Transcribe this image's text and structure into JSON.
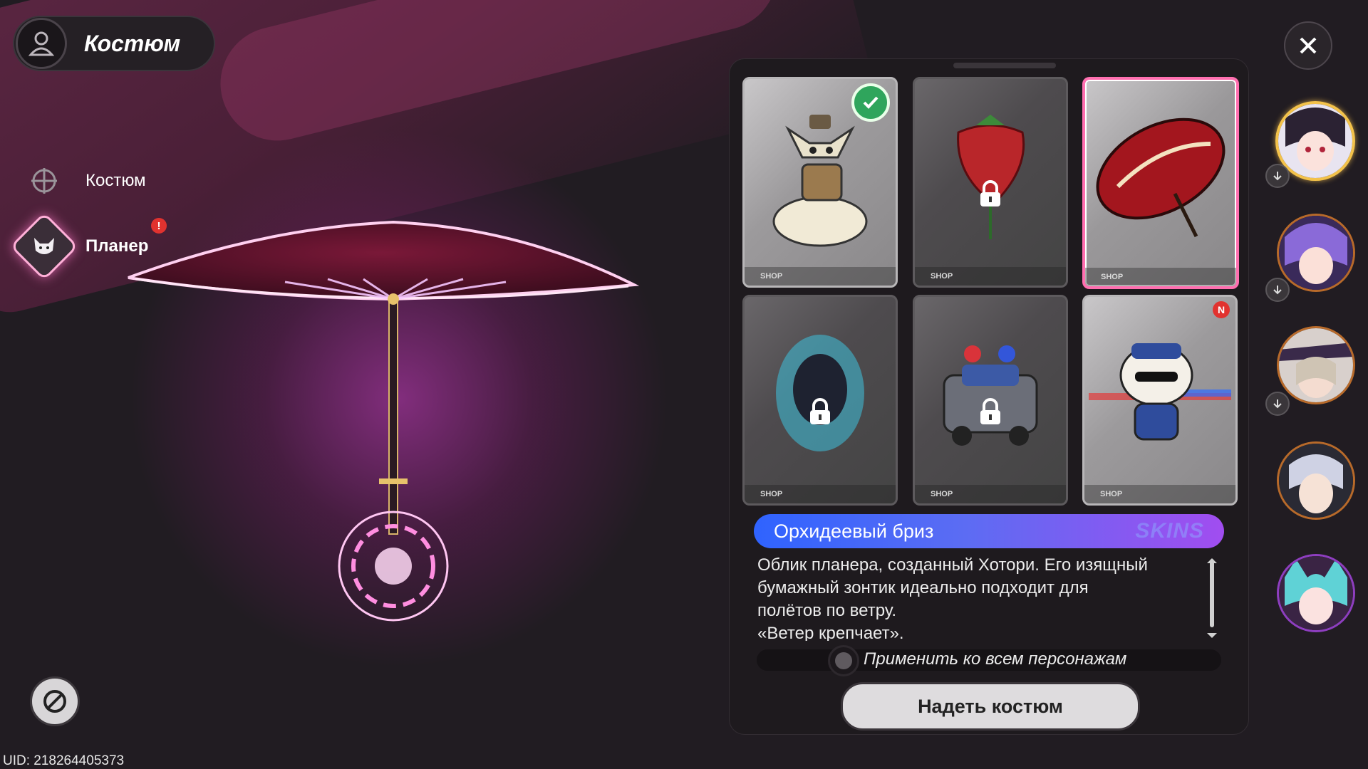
{
  "header": {
    "title": "Костюм",
    "avatar_icon": "person-outline-icon"
  },
  "sidebar": {
    "items": [
      {
        "label": "Костюм",
        "icon": "crosshair-icon",
        "active": false
      },
      {
        "label": "Планер",
        "icon": "glider-mascot-icon",
        "active": true,
        "alert": "!"
      }
    ]
  },
  "controls": {
    "close_icon": "close-icon",
    "block_icon": "block-icon"
  },
  "uid": "UID: 218264405373",
  "cards": [
    {
      "name": "card-mascot-pack",
      "foot": "SHOP",
      "locked": false,
      "equipped": true,
      "new": false,
      "style": "light"
    },
    {
      "name": "card-strawberry",
      "foot": "SHOP",
      "locked": true,
      "equipped": false,
      "new": false,
      "style": "dark"
    },
    {
      "name": "card-orchid-umbrella",
      "foot": "SHOP",
      "locked": false,
      "equipped": false,
      "new": false,
      "style": "selected"
    },
    {
      "name": "card-blue-spirit",
      "foot": "SHOP",
      "locked": true,
      "equipped": false,
      "new": false,
      "style": "dark"
    },
    {
      "name": "card-police-car",
      "foot": "SHOP",
      "locked": true,
      "equipped": false,
      "new": false,
      "style": "dark"
    },
    {
      "name": "card-police-mascot",
      "foot": "SHOP",
      "locked": false,
      "equipped": false,
      "new": true,
      "new_label": "N",
      "style": "light"
    }
  ],
  "detail": {
    "name": "Орхидеевый бриз",
    "tag": "SKINS",
    "description_lines": [
      "Облик планера, созданный Хотори. Его изящный",
      "бумажный зонтик идеально подходит для",
      "полётов по ветру.",
      "«Ветер крепчает»."
    ]
  },
  "apply_all": {
    "label": "Применить ко всем персонажам",
    "checked": false
  },
  "equip_button": {
    "label": "Надеть костюм"
  },
  "colors": {
    "accent_pink": "#ff6fb0",
    "name_bar_start": "#2f63ff",
    "name_bar_end": "#a14df0",
    "equipped_green": "#2fa55c",
    "badge_red": "#e1322f"
  }
}
